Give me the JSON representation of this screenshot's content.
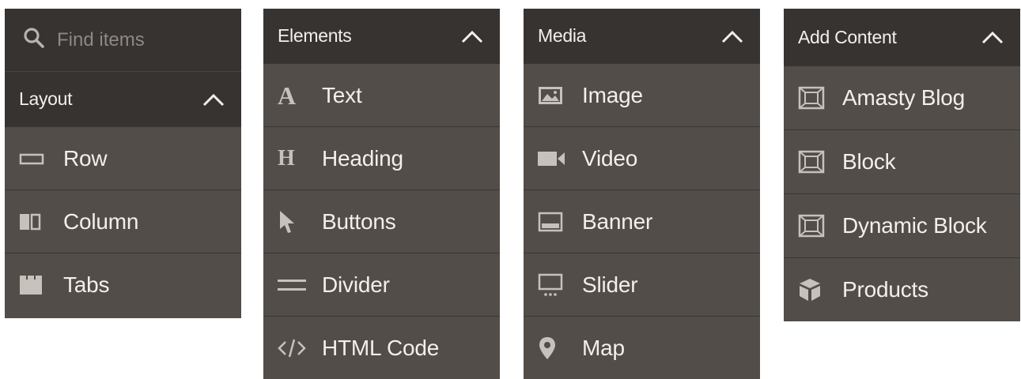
{
  "search": {
    "placeholder": "Find items",
    "value": ""
  },
  "layout": {
    "title": "Layout",
    "items": [
      {
        "label": "Row",
        "icon": "row-icon"
      },
      {
        "label": "Column",
        "icon": "column-icon"
      },
      {
        "label": "Tabs",
        "icon": "tabs-icon"
      }
    ]
  },
  "elements": {
    "title": "Elements",
    "items": [
      {
        "label": "Text",
        "icon": "text-icon",
        "glyph": "A"
      },
      {
        "label": "Heading",
        "icon": "heading-icon",
        "glyph": "H"
      },
      {
        "label": "Buttons",
        "icon": "pointer-icon"
      },
      {
        "label": "Divider",
        "icon": "divider-icon"
      },
      {
        "label": "HTML Code",
        "icon": "code-icon"
      }
    ]
  },
  "media": {
    "title": "Media",
    "items": [
      {
        "label": "Image",
        "icon": "image-icon"
      },
      {
        "label": "Video",
        "icon": "video-icon"
      },
      {
        "label": "Banner",
        "icon": "banner-icon"
      },
      {
        "label": "Slider",
        "icon": "slider-icon"
      },
      {
        "label": "Map",
        "icon": "map-pin-icon"
      }
    ]
  },
  "add_content": {
    "title": "Add Content",
    "items": [
      {
        "label": "Amasty Blog",
        "icon": "block-icon"
      },
      {
        "label": "Block",
        "icon": "block-icon"
      },
      {
        "label": "Dynamic Block",
        "icon": "block-icon"
      },
      {
        "label": "Products",
        "icon": "box-icon"
      }
    ]
  },
  "colors": {
    "header": "#373330",
    "item_bg": "#524d49",
    "text": "#f2efec",
    "icon": "#c7c1bc",
    "divider": "#3a3633"
  }
}
